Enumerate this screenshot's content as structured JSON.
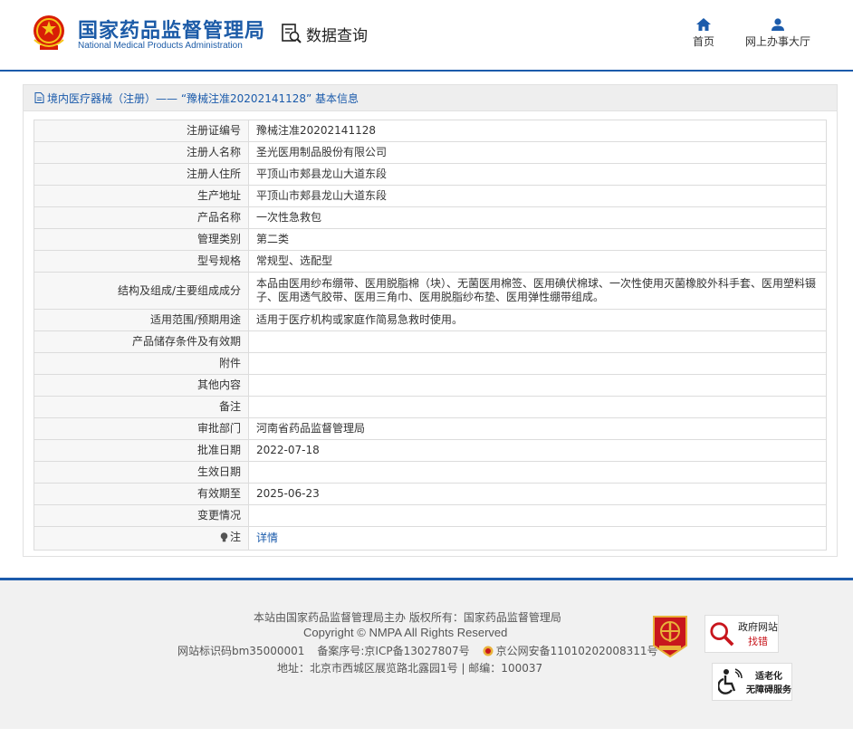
{
  "header": {
    "logo_cn": "国家药品监督管理局",
    "logo_en": "National Medical Products Administration",
    "query_label": "数据查询",
    "nav": [
      {
        "label": "首页",
        "icon": "home-icon"
      },
      {
        "label": "网上办事大厅",
        "icon": "user-icon"
      }
    ],
    "brand_color": "#1b5bab"
  },
  "panel": {
    "title": "境内医疗器械（注册）—— “豫械注准20202141128” 基本信息",
    "rows": [
      {
        "key": "注册证编号",
        "value": "豫械注准20202141128"
      },
      {
        "key": "注册人名称",
        "value": "圣光医用制品股份有限公司"
      },
      {
        "key": "注册人住所",
        "value": "平顶山市郏县龙山大道东段"
      },
      {
        "key": "生产地址",
        "value": "平顶山市郏县龙山大道东段"
      },
      {
        "key": "产品名称",
        "value": "一次性急救包"
      },
      {
        "key": "管理类别",
        "value": "第二类"
      },
      {
        "key": "型号规格",
        "value": "常规型、选配型"
      },
      {
        "key": "结构及组成/主要组成成分",
        "value": "本品由医用纱布绷带、医用脱脂棉（块）、无菌医用棉签、医用碘伏棉球、一次性使用灭菌橡胶外科手套、医用塑料镊子、医用透气胶带、医用三角巾、医用脱脂纱布垫、医用弹性绷带组成。"
      },
      {
        "key": "适用范围/预期用途",
        "value": "适用于医疗机构或家庭作简易急救时使用。"
      },
      {
        "key": "产品储存条件及有效期",
        "value": ""
      },
      {
        "key": "附件",
        "value": ""
      },
      {
        "key": "其他内容",
        "value": ""
      },
      {
        "key": "备注",
        "value": ""
      },
      {
        "key": "审批部门",
        "value": "河南省药品监督管理局"
      },
      {
        "key": "批准日期",
        "value": "2022-07-18"
      },
      {
        "key": "生效日期",
        "value": ""
      },
      {
        "key": "有效期至",
        "value": "2025-06-23"
      },
      {
        "key": "变更情况",
        "value": ""
      }
    ],
    "note_key": "注",
    "note_link": "详情"
  },
  "footer": {
    "line1": "本站由国家药品监督管理局主办 版权所有：国家药品监督管理局",
    "line2": "Copyright © NMPA All Rights Reserved",
    "site_code": "网站标识码bm35000001",
    "icp": "备案序号:京ICP备13027807号",
    "police": "京公网安备11010202008311号",
    "address": "地址：北京市西城区展览路北露园1号 | 邮编：100037",
    "gov_badge_1": "政府网站",
    "gov_badge_2": "找错",
    "access_1": "适老化",
    "access_2": "无障碍服务"
  }
}
